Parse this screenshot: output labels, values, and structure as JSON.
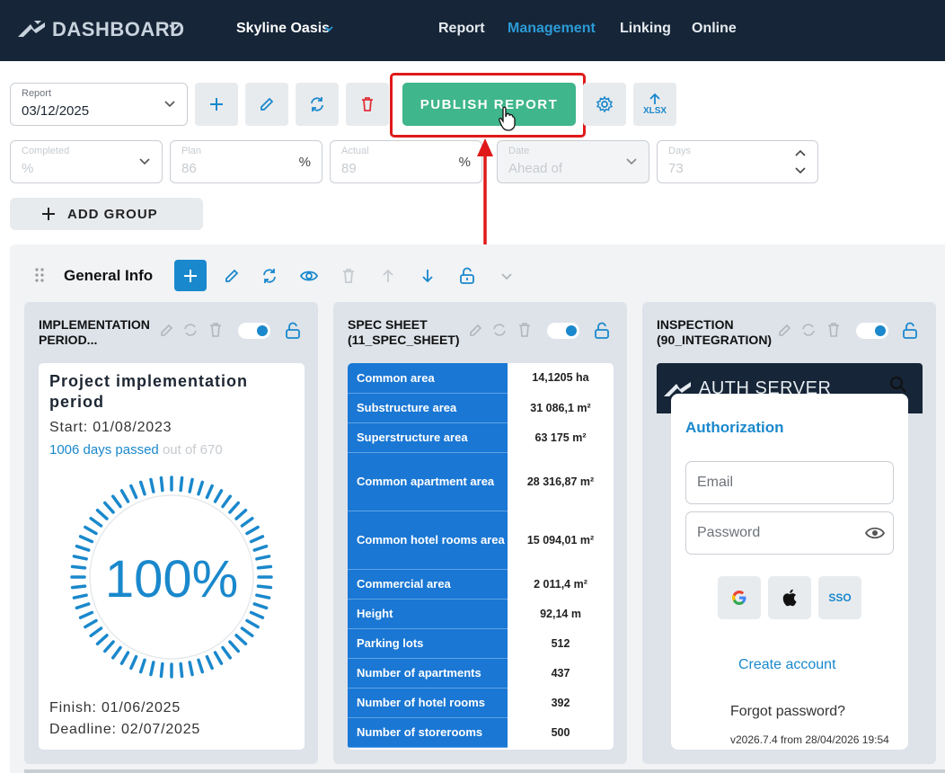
{
  "header": {
    "brand": "DASHBOARD",
    "project": "Skyline Oasis",
    "nav": [
      "Report",
      "Management",
      "Linking",
      "Online"
    ],
    "active_nav": "Management"
  },
  "toolbar": {
    "report_label": "Report",
    "report_value": "03/12/2025",
    "publish_label": "PUBLISH REPORT",
    "xlsx_label": "XLSX",
    "completed_label": "Completed",
    "completed_value": "%",
    "plan_label": "Plan",
    "plan_value": "86",
    "actual_label": "Actual",
    "actual_value": "89",
    "date_label": "Date",
    "date_value": "Ahead of",
    "days_label": "Days",
    "days_value": "73",
    "percent_suffix": "%",
    "add_group_label": "ADD GROUP"
  },
  "group": {
    "title": "General Info"
  },
  "cards": {
    "implementation": {
      "title": "IMPLEMENTATION PERIOD...",
      "heading": "Project implementation period",
      "start": "Start: 01/08/2023",
      "days_passed": "1006 days passed",
      "out_of": "out of 670",
      "percent": "100%",
      "progress": 1.0,
      "finish": "Finish: 01/06/2025",
      "deadline": "Deadline: 02/07/2025"
    },
    "spec": {
      "title_line1": "SPEC SHEET",
      "title_line2": "(11_SPEC_SHEET)",
      "rows": [
        {
          "k": "Common area",
          "v": "14,1205 ha"
        },
        {
          "k": "Substructure area",
          "v": "31 086,1 m²"
        },
        {
          "k": "Superstructure area",
          "v": "63 175 m²"
        },
        {
          "k": "Common apartment area",
          "v": "28 316,87 m²"
        },
        {
          "k": "Common hotel rooms area",
          "v": "15 094,01 m²"
        },
        {
          "k": "Commercial area",
          "v": "2 011,4 m²"
        },
        {
          "k": "Height",
          "v": "92,14 m"
        },
        {
          "k": "Parking lots",
          "v": "512"
        },
        {
          "k": "Number of apartments",
          "v": "437"
        },
        {
          "k": "Number of hotel rooms",
          "v": "392"
        },
        {
          "k": "Number of storerooms",
          "v": "500"
        }
      ]
    },
    "inspection": {
      "title_line1": "INSPECTION",
      "title_line2": "(90_INTEGRATION)",
      "server": "AUTH SERVER",
      "auth_title": "Authorization",
      "email_placeholder": "Email",
      "password_placeholder": "Password",
      "sso_label": "SSO",
      "create_account": "Create account",
      "forgot_password": "Forgot password?",
      "version": "v2026.7.4 from 28/04/2026 19:54"
    }
  },
  "colors": {
    "topbar": "#162537",
    "accent": "#1a88cc",
    "publish": "#3fb68b",
    "highlight": "#e01a1a"
  }
}
